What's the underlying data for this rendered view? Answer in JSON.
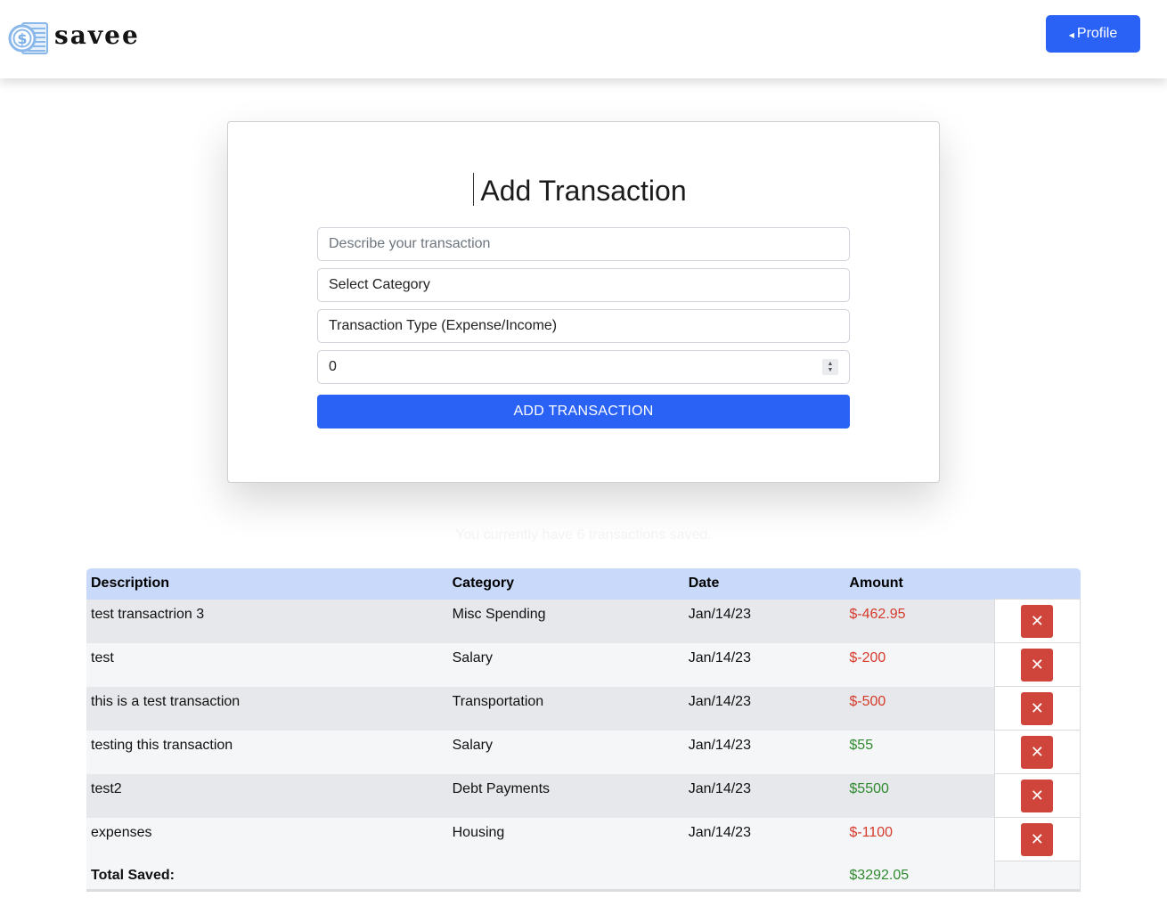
{
  "header": {
    "logo_text": "savee",
    "profile_label": "Profile"
  },
  "form": {
    "title": "Add Transaction",
    "description_placeholder": "Describe your transaction",
    "category_value": "Select Category",
    "type_value": "Transaction Type (Expense/Income)",
    "amount_value": "0",
    "submit_label": "ADD TRANSACTION"
  },
  "summary_text": "You currently have 6 transactions saved.",
  "table": {
    "columns": [
      "Description",
      "Category",
      "Date",
      "Amount"
    ],
    "rows": [
      {
        "description": "test transactrion 3",
        "category": "Misc Spending",
        "date": "Jan/14/23",
        "amount": "$-462.95",
        "sign": "negative"
      },
      {
        "description": "test",
        "category": "Salary",
        "date": "Jan/14/23",
        "amount": "$-200",
        "sign": "negative"
      },
      {
        "description": "this is a test transaction",
        "category": "Transportation",
        "date": "Jan/14/23",
        "amount": "$-500",
        "sign": "negative"
      },
      {
        "description": "testing this transaction",
        "category": "Salary",
        "date": "Jan/14/23",
        "amount": "$55",
        "sign": "positive"
      },
      {
        "description": "test2",
        "category": "Debt Payments",
        "date": "Jan/14/23",
        "amount": "$5500",
        "sign": "positive"
      },
      {
        "description": "expenses",
        "category": "Housing",
        "date": "Jan/14/23",
        "amount": "$-1100",
        "sign": "negative"
      }
    ],
    "delete_glyph": "✕",
    "total_label": "Total Saved:",
    "total_value": "$3292.05"
  },
  "colors": {
    "accent": "#2962f5",
    "delete": "#d0453b",
    "negative": "#d63a2a",
    "positive": "#2f8a2f",
    "header_row": "#c8d9f9"
  }
}
